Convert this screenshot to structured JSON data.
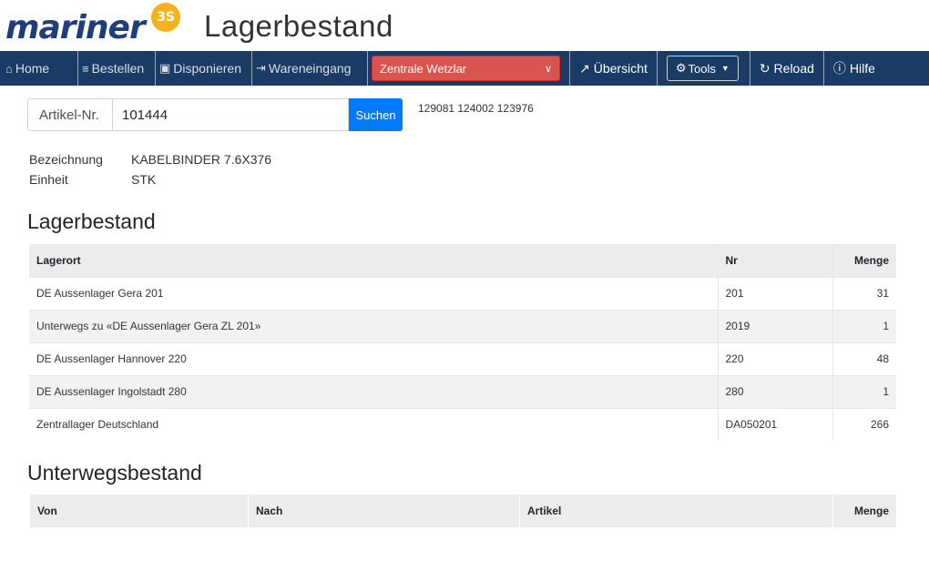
{
  "header": {
    "logo_text": "mariner",
    "logo_badge": "3S",
    "title": "Lagerbestand"
  },
  "nav": {
    "home": "Home",
    "bestellen": "Bestellen",
    "disponieren": "Disponieren",
    "wareneingang": "Wareneingang",
    "branch": "Zentrale Wetzlar",
    "uebersicht": "Übersicht",
    "tools": "Tools",
    "reload": "Reload",
    "hilfe": "Hilfe"
  },
  "search": {
    "label": "Artikel-Nr.",
    "value": "101444",
    "button": "Suchen",
    "recent": "129081 124002 123976"
  },
  "details": [
    {
      "key": "Bezeichnung",
      "value": "KABELBINDER 7.6X376"
    },
    {
      "key": "Einheit",
      "value": "STK"
    }
  ],
  "lagerbestand": {
    "title": "Lagerbestand",
    "headers": [
      "Lagerort",
      "Nr",
      "Menge"
    ],
    "rows": [
      {
        "lagerort": "DE Aussenlager Gera 201",
        "nr": "201",
        "menge": "31"
      },
      {
        "lagerort": "Unterwegs zu «DE Aussenlager Gera ZL 201»",
        "nr": "2019",
        "menge": "1"
      },
      {
        "lagerort": "DE Aussenlager Hannover 220",
        "nr": "220",
        "menge": "48"
      },
      {
        "lagerort": "DE Aussenlager Ingolstadt 280",
        "nr": "280",
        "menge": "1"
      },
      {
        "lagerort": "Zentrallager Deutschland",
        "nr": "DA050201",
        "menge": "266"
      }
    ]
  },
  "unterwegsbestand": {
    "title": "Unterwegsbestand",
    "headers": [
      "Von",
      "Nach",
      "Artikel",
      "Menge"
    ]
  },
  "colors": {
    "navbar": "#1b3a64",
    "branch_select": "#d9534f",
    "search_button": "#007bff",
    "logo": "#1f3d7a",
    "logo_badge": "#f5b21b"
  }
}
